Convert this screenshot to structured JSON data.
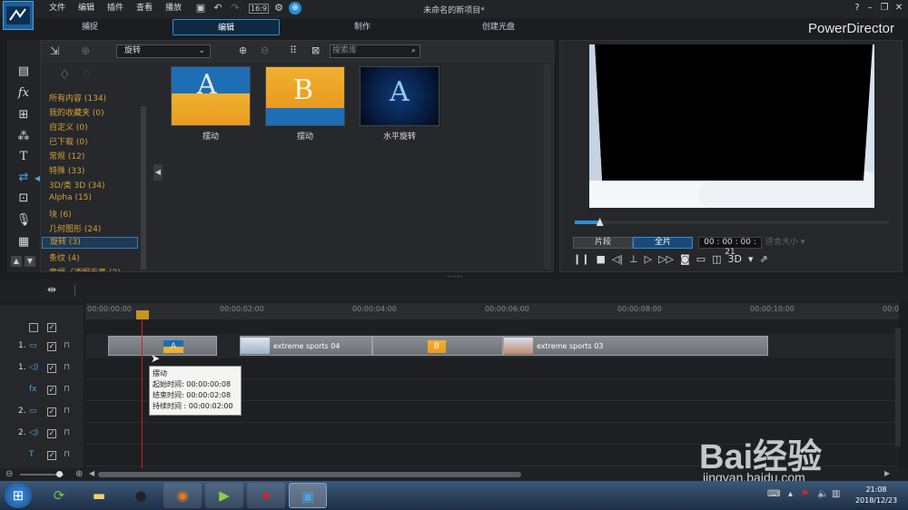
{
  "window": {
    "title": "未命名的新项目*",
    "brand": "PowerDirector"
  },
  "menu": [
    "文件",
    "编辑",
    "插件",
    "查看",
    "播放"
  ],
  "tabs": [
    {
      "label": "捕捉",
      "active": false
    },
    {
      "label": "编辑",
      "active": true
    },
    {
      "label": "制作",
      "active": false
    },
    {
      "label": "创建光盘",
      "active": false
    }
  ],
  "library": {
    "category_select": "旋转",
    "search_placeholder": "搜索库",
    "categories": [
      "所有内容 (134)",
      "我的收藏夹 (0)",
      "自定义 (0)",
      "已下载 (0)",
      "常规 (12)",
      "特殊 (33)",
      "3D/类 3D (34)",
      "Alpha (15)",
      "块 (6)",
      "几何图形 (24)",
      "旋转 (3)",
      "条纹 (4)",
      "章幅（透明无章 (2)"
    ],
    "selected_category": 10,
    "items": [
      {
        "label": "摆动",
        "glyph": "A"
      },
      {
        "label": "摆动",
        "glyph": "B"
      },
      {
        "label": "水平旋转",
        "glyph": "A"
      }
    ]
  },
  "preview": {
    "mode_clip": "片段",
    "mode_movie": "全片",
    "timecode": "00 : 00 : 00 : 21",
    "size_select": "适合大小",
    "three_d": "3D",
    "progress": 0.08
  },
  "timeline": {
    "ruler": [
      "00:00:00:00",
      "00:00:02:00",
      "00:00:04:00",
      "00:00:06:00",
      "00:00:08:00",
      "00:00:10:00",
      "00:0"
    ],
    "tracks": [
      "1.",
      "1.",
      "",
      "2.",
      "2.",
      "",
      ""
    ],
    "clips": [
      {
        "label": "extreme sports 04"
      },
      {
        "label": "extreme sports 03"
      }
    ]
  },
  "tooltip": {
    "name": "摆动",
    "start": "起始时间: 00:00:00:08",
    "end": "结束时间: 00:00:02:08",
    "duration": "持续时间 :  00:00:02:00"
  },
  "taskbar": {
    "time": "21:08",
    "date": "2018/12/23"
  },
  "watermark": {
    "text": "Bai经验",
    "url": "jingyan.baidu.com"
  },
  "colors": {
    "accent": "#2c8fd6",
    "category_text": "#d2a038",
    "playhead": "#e02020"
  }
}
